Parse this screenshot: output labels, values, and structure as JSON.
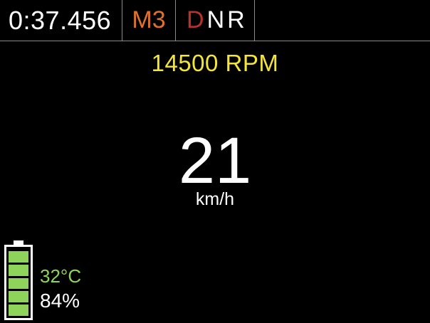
{
  "header": {
    "lap_time": "0:37.456",
    "mode": "M3",
    "gears": [
      {
        "label": "D",
        "active": true
      },
      {
        "label": "N",
        "active": false
      },
      {
        "label": "R",
        "active": false
      }
    ]
  },
  "rpm": {
    "value": "14500",
    "unit": "RPM",
    "text": "14500 RPM"
  },
  "speed": {
    "value": "21",
    "unit": "km/h"
  },
  "battery": {
    "temperature": "32°C",
    "charge_text": "84%",
    "charge_level": 0.84,
    "cells_filled": 5,
    "cells_total": 5
  },
  "colors": {
    "background": "#000000",
    "mode": "#e0712a",
    "gear_active": "#b8312a",
    "rpm": "#f5e53a",
    "battery": "#8ed45a",
    "divider": "#8a8a8a"
  }
}
